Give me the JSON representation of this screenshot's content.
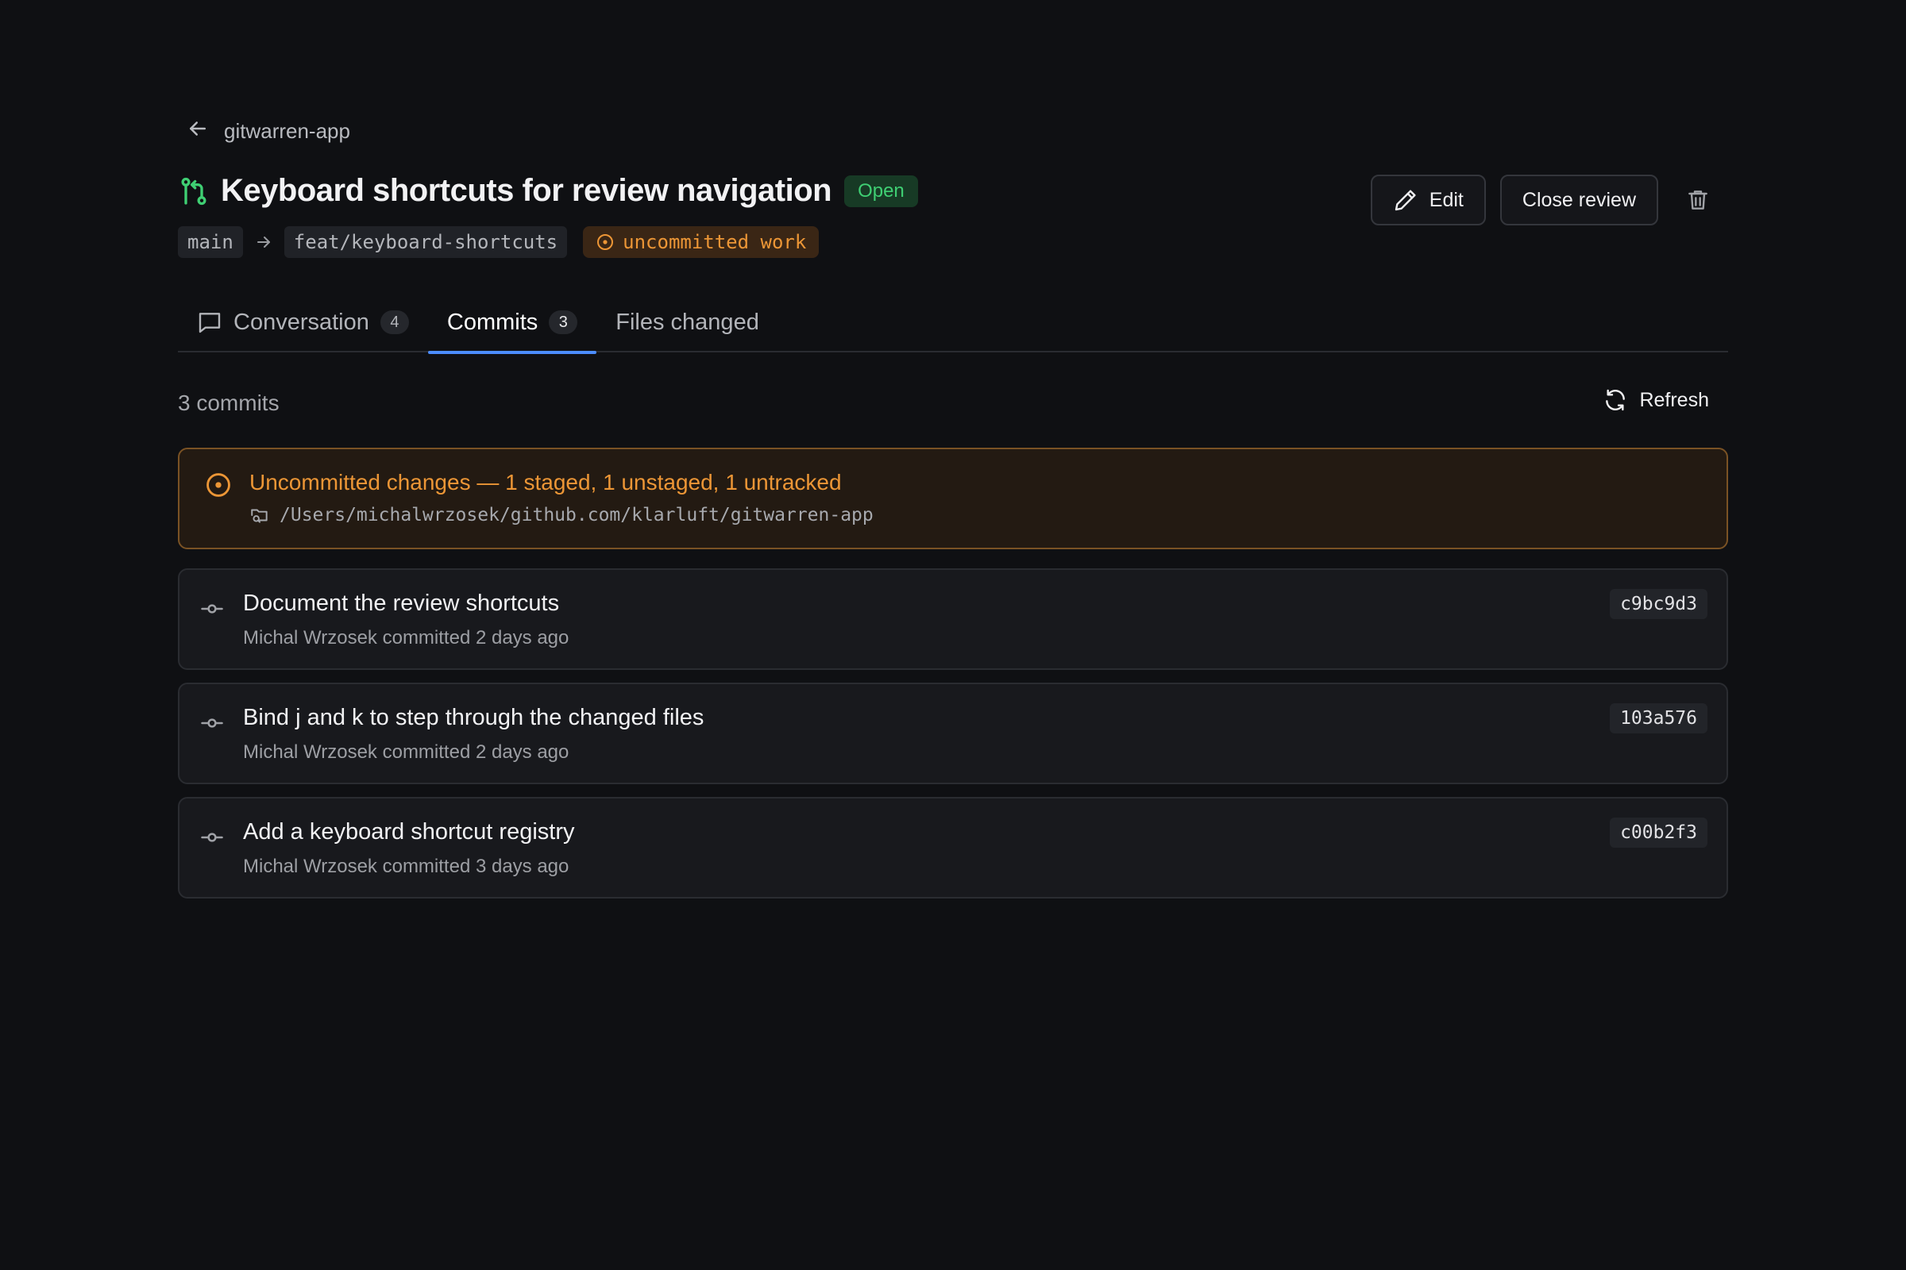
{
  "breadcrumb": {
    "label": "gitwarren-app",
    "icon": "arrow-left-icon"
  },
  "header": {
    "title": "Keyboard shortcuts for review navigation",
    "status": "Open",
    "status_color": "#3fcf73",
    "base_branch": "main",
    "head_branch": "feat/keyboard-shortcuts",
    "warning_label": "uncommitted work",
    "warning_color": "#ec9636"
  },
  "actions": {
    "edit_label": "Edit",
    "close_label": "Close review",
    "delete_icon": "trash-icon"
  },
  "tabs": [
    {
      "label": "Conversation",
      "count": "4",
      "icon": "comment-icon",
      "active": false
    },
    {
      "label": "Commits",
      "count": "3",
      "active": true
    },
    {
      "label": "Files changed",
      "active": false
    }
  ],
  "commits_section": {
    "count_label": "3 commits",
    "refresh_label": "Refresh",
    "accent_color": "#4c8dff"
  },
  "uncommitted": {
    "title": "Uncommitted changes — 1 staged, 1 unstaged, 1 untracked",
    "path": "/Users/michalwrzosek/github.com/klarluft/gitwarren-app"
  },
  "commits": [
    {
      "message": "Document the review shortcuts",
      "meta": "Michal Wrzosek committed 2 days ago",
      "sha": "c9bc9d3"
    },
    {
      "message": "Bind j and k to step through the changed files",
      "meta": "Michal Wrzosek committed 2 days ago",
      "sha": "103a576"
    },
    {
      "message": "Add a keyboard shortcut registry",
      "meta": "Michal Wrzosek committed 3 days ago",
      "sha": "c00b2f3"
    }
  ]
}
